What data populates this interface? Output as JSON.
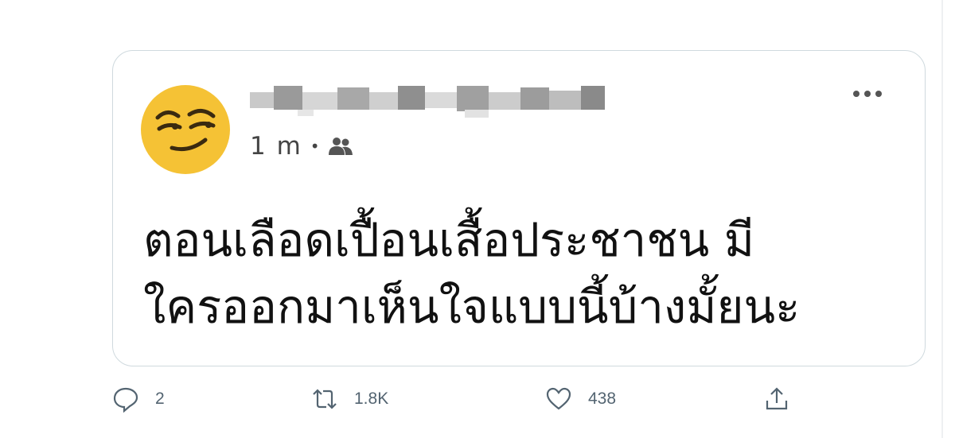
{
  "tweet": {
    "avatar_icon": "smirking-face-emoji",
    "author_name": "",
    "time": "1 m",
    "separator": "•",
    "audience_icon": "friends-icon",
    "more_icon": "more-horizontal-icon",
    "text": "ตอนเลือดเปื้อนเสื้อประชาชน มี\nใครออกมาเห็นใจแบบนี้บ้างมั้ยนะ"
  },
  "actions": {
    "reply": {
      "icon": "reply-icon",
      "count": "2"
    },
    "retweet": {
      "icon": "retweet-icon",
      "count": "1.8K"
    },
    "like": {
      "icon": "heart-icon",
      "count": "438"
    },
    "share": {
      "icon": "share-icon"
    }
  },
  "colors": {
    "card_border": "#cfd9de",
    "action_gray": "#536471",
    "emoji_yellow": "#f5c235"
  }
}
